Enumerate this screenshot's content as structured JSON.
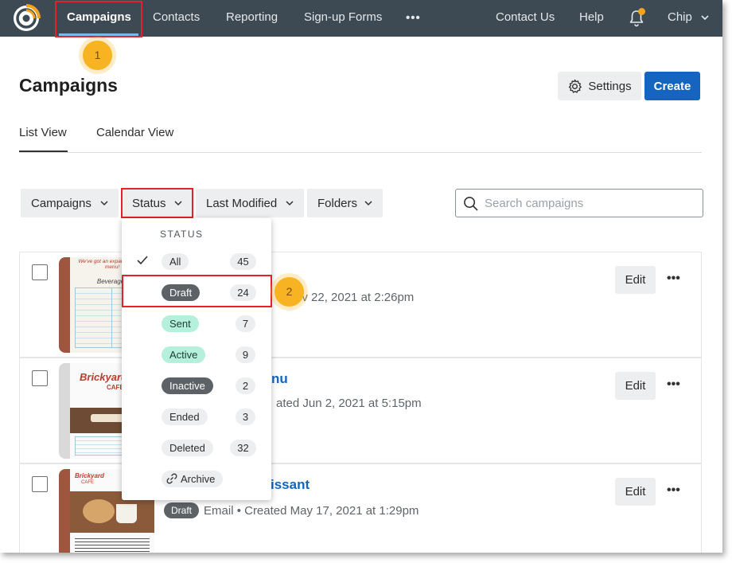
{
  "nav": {
    "items": [
      {
        "label": "Campaigns",
        "active": true
      },
      {
        "label": "Contacts"
      },
      {
        "label": "Reporting"
      },
      {
        "label": "Sign-up Forms"
      }
    ],
    "more": "•••",
    "right": [
      {
        "label": "Contact Us"
      },
      {
        "label": "Help"
      }
    ],
    "user": "Chip",
    "notification_dot_color": "#f7a21b"
  },
  "callouts": {
    "one": "1",
    "two": "2"
  },
  "page": {
    "title": "Campaigns",
    "settings_label": "Settings",
    "create_label": "Create"
  },
  "tabs": [
    {
      "label": "List View",
      "active": true
    },
    {
      "label": "Calendar View"
    }
  ],
  "filters": [
    {
      "label": "Campaigns"
    },
    {
      "label": "Status"
    },
    {
      "label": "Last Modified"
    },
    {
      "label": "Folders"
    }
  ],
  "search": {
    "placeholder": "Search campaigns"
  },
  "status_menu": {
    "header": "STATUS",
    "items": [
      {
        "label": "All",
        "count": "45",
        "selected": true
      },
      {
        "label": "Draft",
        "count": "24"
      },
      {
        "label": "Sent",
        "count": "7"
      },
      {
        "label": "Active",
        "count": "9"
      },
      {
        "label": "Inactive",
        "count": "2"
      },
      {
        "label": "Ended",
        "count": "3"
      },
      {
        "label": "Deleted",
        "count": "32"
      },
      {
        "label": "Archive"
      }
    ]
  },
  "campaigns": [
    {
      "title": "",
      "meta": "ov 22, 2021 at 2:26pm",
      "edit": "Edit"
    },
    {
      "title": "nu",
      "meta": "ated Jun 2, 2021 at 5:15pm",
      "edit": "Edit"
    },
    {
      "title": "issant",
      "status": "Draft",
      "meta": "Email  •  Created May 17, 2021 at 1:29pm",
      "edit": "Edit"
    }
  ],
  "thumb_text": {
    "t1_headline": "We've got an expanded lunch menu!",
    "t1_sub": "Beverages",
    "t2_brand": "Brickyard",
    "t2_sub": "CAFE",
    "t3_brand": "Brickyard",
    "t3_sub": "CAFE"
  },
  "colors": {
    "nav_bg": "#3d4a54",
    "primary": "#1565c0",
    "highlight": "#e42328",
    "callout": "#f7b321"
  }
}
